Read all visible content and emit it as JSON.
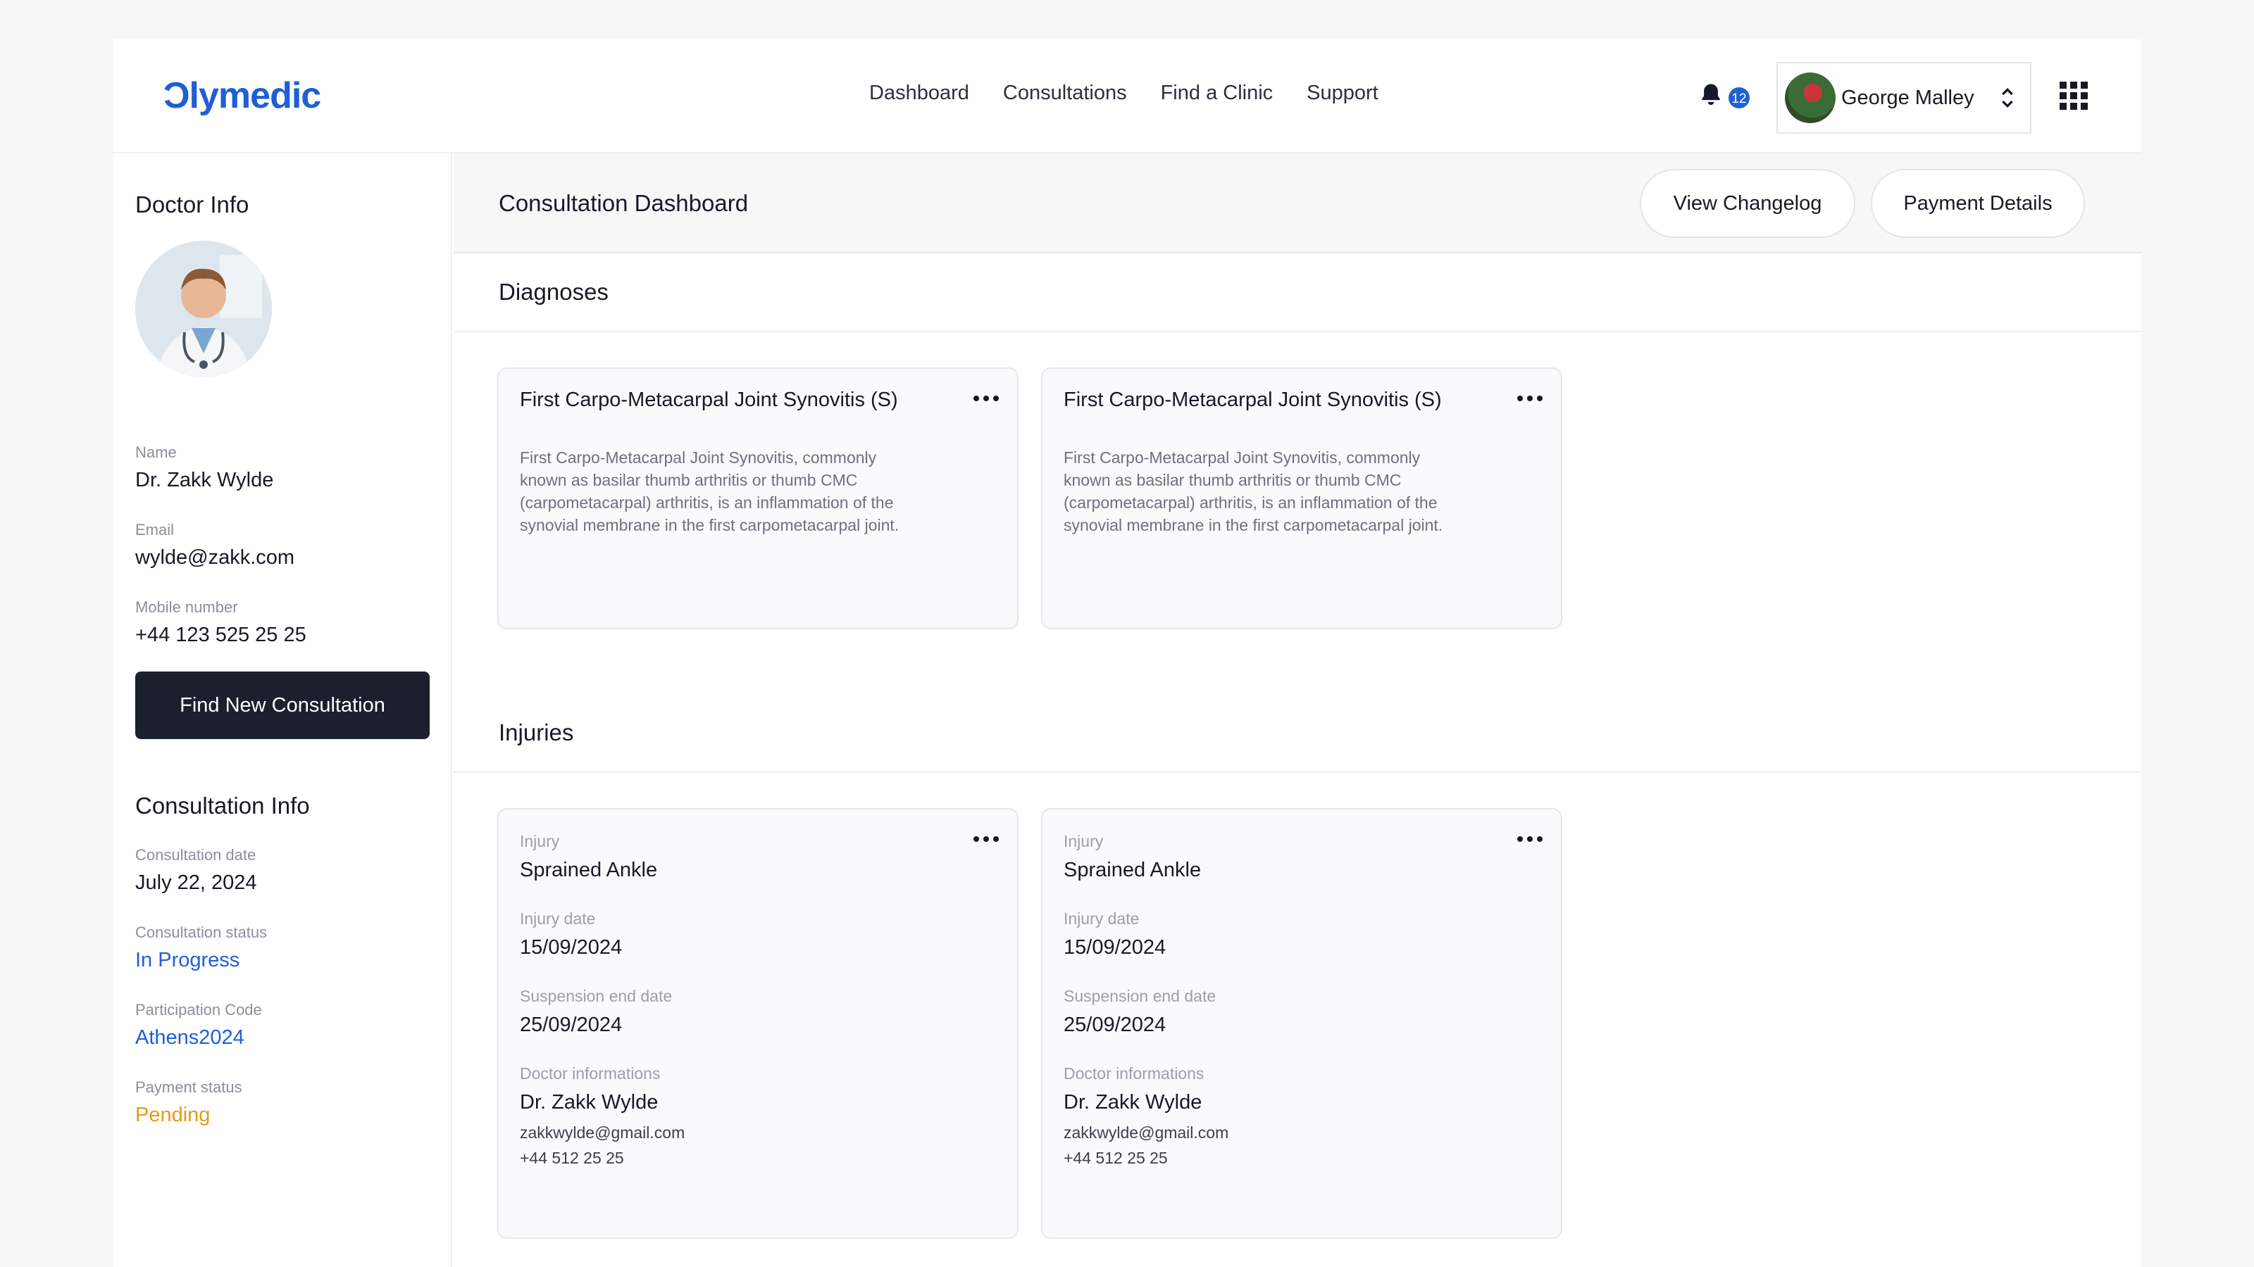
{
  "header": {
    "logo": "Ɔlymedic",
    "nav": [
      "Dashboard",
      "Consultations",
      "Find a Clinic",
      "Support"
    ],
    "notification_count": "12",
    "user_name": "George Malley"
  },
  "sidebar": {
    "doctor_title": "Doctor Info",
    "name_label": "Name",
    "name_value": "Dr. Zakk Wylde",
    "email_label": "Email",
    "email_value": "wylde@zakk.com",
    "mobile_label": "Mobile number",
    "mobile_value": "+44 123 525 25 25",
    "find_button": "Find New Consultation",
    "consult_title": "Consultation Info",
    "date_label": "Consultation date",
    "date_value": "July 22, 2024",
    "status_label": "Consultation status",
    "status_value": "In Progress",
    "code_label": "Participation Code",
    "code_value": "Athens2024",
    "payment_label": "Payment status",
    "payment_value": "Pending"
  },
  "main": {
    "title": "Consultation Dashboard",
    "changelog_button": "View Changelog",
    "payment_button": "Payment Details",
    "diagnoses_title": "Diagnoses",
    "injuries_title": "Injuries",
    "diagnoses": [
      {
        "title": "First Carpo-Metacarpal Joint Synovitis (S)",
        "lines": [
          "First Carpo-Metacarpal Joint Synovitis, commonly",
          "known as basilar thumb arthritis or thumb CMC",
          "(carpometacarpal) arthritis, is an inflammation of the",
          "synovial membrane in the first carpometacarpal joint."
        ]
      },
      {
        "title": "First Carpo-Metacarpal Joint Synovitis (S)",
        "lines": [
          "First Carpo-Metacarpal Joint Synovitis, commonly",
          "known as basilar thumb arthritis or thumb CMC",
          "(carpometacarpal) arthritis, is an inflammation of the",
          "synovial membrane in the first carpometacarpal joint."
        ]
      }
    ],
    "injuries": [
      {
        "injury_label": "Injury",
        "injury_value": "Sprained Ankle",
        "date_label": "Injury date",
        "date_value": "15/09/2024",
        "suspension_label": "Suspension end date",
        "suspension_value": "25/09/2024",
        "doctor_label": "Doctor informations",
        "doctor_name": "Dr. Zakk Wylde",
        "doctor_email": "zakkwylde@gmail.com",
        "doctor_phone": "+44 512 25 25"
      },
      {
        "injury_label": "Injury",
        "injury_value": "Sprained Ankle",
        "date_label": "Injury date",
        "date_value": "15/09/2024",
        "suspension_label": "Suspension end date",
        "suspension_value": "25/09/2024",
        "doctor_label": "Doctor informations",
        "doctor_name": "Dr. Zakk Wylde",
        "doctor_email": "zakkwylde@gmail.com",
        "doctor_phone": "+44 512 25 25"
      }
    ]
  },
  "colors": {
    "accent": "#1f5fd6",
    "dark_button": "#1b1f2e",
    "pending": "#e59a11"
  },
  "icons": [
    "bell-icon",
    "chevron-updown-icon",
    "apps-grid-icon",
    "more-icon"
  ]
}
